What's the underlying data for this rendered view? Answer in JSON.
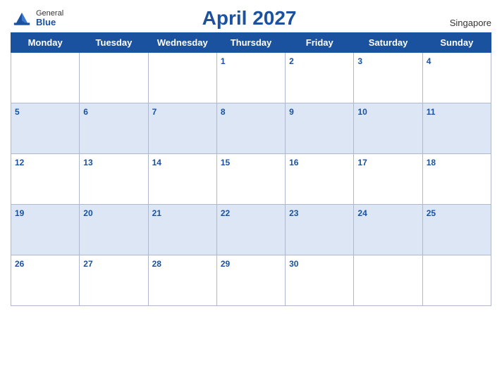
{
  "header": {
    "logo_general": "General",
    "logo_blue": "Blue",
    "title": "April 2027",
    "location": "Singapore"
  },
  "weekdays": [
    "Monday",
    "Tuesday",
    "Wednesday",
    "Thursday",
    "Friday",
    "Saturday",
    "Sunday"
  ],
  "weeks": [
    [
      null,
      null,
      null,
      1,
      2,
      3,
      4
    ],
    [
      5,
      6,
      7,
      8,
      9,
      10,
      11
    ],
    [
      12,
      13,
      14,
      15,
      16,
      17,
      18
    ],
    [
      19,
      20,
      21,
      22,
      23,
      24,
      25
    ],
    [
      26,
      27,
      28,
      29,
      30,
      null,
      null
    ]
  ],
  "row_styles": [
    "white",
    "blue",
    "white",
    "blue",
    "white"
  ]
}
